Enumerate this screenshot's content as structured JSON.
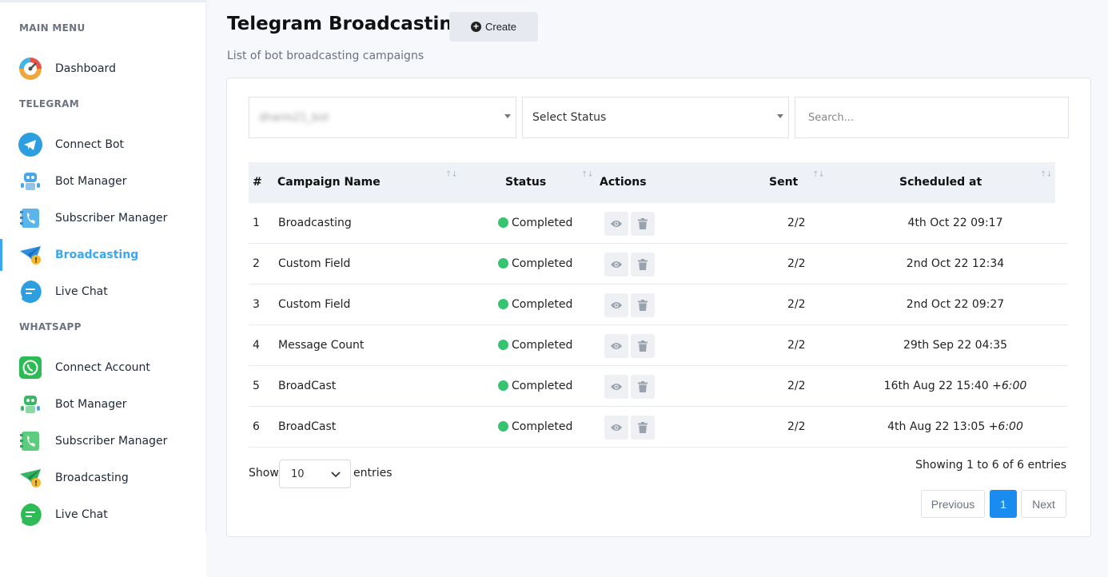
{
  "sidebar": {
    "headers": {
      "main": "MAIN MENU",
      "telegram": "TELEGRAM",
      "whatsapp": "WHATSAPP"
    },
    "main_items": [
      {
        "label": "Dashboard",
        "icon": "dashboard-gauge-icon"
      }
    ],
    "telegram_items": [
      {
        "label": "Connect Bot",
        "icon": "telegram-icon"
      },
      {
        "label": "Bot Manager",
        "icon": "robot-icon"
      },
      {
        "label": "Subscriber Manager",
        "icon": "subscriber-phone-icon"
      },
      {
        "label": "Broadcasting",
        "icon": "broadcast-plane-icon",
        "active": true
      },
      {
        "label": "Live Chat",
        "icon": "chat-bubble-icon"
      }
    ],
    "whatsapp_items": [
      {
        "label": "Connect Account",
        "icon": "whatsapp-icon"
      },
      {
        "label": "Bot Manager",
        "icon": "robot-icon"
      },
      {
        "label": "Subscriber Manager",
        "icon": "subscriber-phone-icon"
      },
      {
        "label": "Broadcasting",
        "icon": "broadcast-plane-icon"
      },
      {
        "label": "Live Chat",
        "icon": "chat-bubble-icon"
      }
    ]
  },
  "header": {
    "title": "Telegram Broadcasting",
    "create_label": "Create",
    "subtitle": "List of bot broadcasting campaigns"
  },
  "filters": {
    "bot_select_value": "dhanis21_bot",
    "status_select_value": "Select Status",
    "search_placeholder": "Search..."
  },
  "table": {
    "columns": [
      "#",
      "Campaign Name",
      "Status",
      "Actions",
      "Sent",
      "Scheduled at"
    ],
    "rows": [
      {
        "num": "1",
        "name": "Broadcasting",
        "status": "Completed",
        "sent": "2/2",
        "scheduled": "4th Oct 22 09:17",
        "tz": ""
      },
      {
        "num": "2",
        "name": "Custom Field",
        "status": "Completed",
        "sent": "2/2",
        "scheduled": "2nd Oct 22 12:34",
        "tz": ""
      },
      {
        "num": "3",
        "name": "Custom Field",
        "status": "Completed",
        "sent": "2/2",
        "scheduled": "2nd Oct 22 09:27",
        "tz": ""
      },
      {
        "num": "4",
        "name": "Message Count",
        "status": "Completed",
        "sent": "2/2",
        "scheduled": "29th Sep 22 04:35",
        "tz": ""
      },
      {
        "num": "5",
        "name": "BroadCast",
        "status": "Completed",
        "sent": "2/2",
        "scheduled": "16th Aug 22 15:40",
        "tz": "+6:00"
      },
      {
        "num": "6",
        "name": "BroadCast",
        "status": "Completed",
        "sent": "2/2",
        "scheduled": "4th Aug 22 13:05",
        "tz": "+6:00"
      }
    ]
  },
  "footer": {
    "show_label": "Show",
    "page_length": "10",
    "entries_label": "entries",
    "info": "Showing 1 to 6 of 6 entries",
    "previous": "Previous",
    "current_page": "1",
    "next": "Next"
  },
  "colors": {
    "accent": "#3ba7f0",
    "status_completed": "#35c46f",
    "pagination_active": "#1a8cf0"
  }
}
